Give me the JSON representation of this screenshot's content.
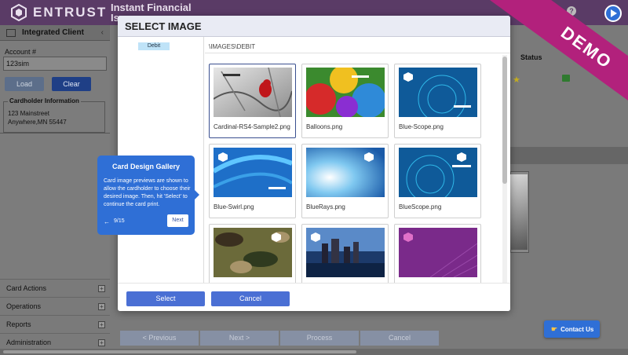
{
  "header": {
    "brand": "ENTRUST",
    "app_title": "Instant Financial",
    "app_title_sub": "Issuance",
    "help_glyph": "?"
  },
  "left_panel": {
    "title": "Integrated Client",
    "collapse_glyph": "‹",
    "account_label": "Account #",
    "account_value": "123sim",
    "load_label": "Load",
    "clear_label": "Clear",
    "cardholder_legend": "Cardholder Information",
    "address_line1": "123 Mainstreet",
    "address_line2": "Anywhere,MN 55447",
    "menu": [
      {
        "label": "Card Actions"
      },
      {
        "label": "Operations"
      },
      {
        "label": "Reports"
      },
      {
        "label": "Administration"
      }
    ]
  },
  "background": {
    "status_header": "Status",
    "wizard_buttons": [
      "< Previous",
      "Next >",
      "Process",
      "Cancel"
    ]
  },
  "modal": {
    "title": "SELECT IMAGE",
    "folder": "Debit",
    "path": "\\IMAGES\\DEBIT",
    "images": [
      {
        "name": "Cardinal-RS4-Sample2.png",
        "selected": true
      },
      {
        "name": "Balloons.png",
        "selected": false
      },
      {
        "name": "Blue-Scope.png",
        "selected": false
      },
      {
        "name": "Blue-Swirl.png",
        "selected": false
      },
      {
        "name": "BlueRays.png",
        "selected": false
      },
      {
        "name": "BlueScope.png",
        "selected": false
      },
      {
        "name": "",
        "selected": false
      },
      {
        "name": "",
        "selected": false
      },
      {
        "name": "",
        "selected": false
      }
    ],
    "select_label": "Select",
    "cancel_label": "Cancel"
  },
  "tooltip": {
    "title": "Card Design Gallery",
    "body": "Card image previews are shown to allow the cardholder to choose their desired image. Then, hit 'Select' to continue the card print.",
    "prev_glyph": "←",
    "step": "9/15",
    "next_label": "Next"
  },
  "ribbon": {
    "text": "DEMO"
  },
  "contact": {
    "icon": "hand-point-icon",
    "label": "Contact Us"
  },
  "colors": {
    "header_bg": "#5a3b66",
    "accent_blue": "#2f6fd6",
    "button_blue": "#4a6fd4",
    "ribbon": "#b2217c"
  }
}
